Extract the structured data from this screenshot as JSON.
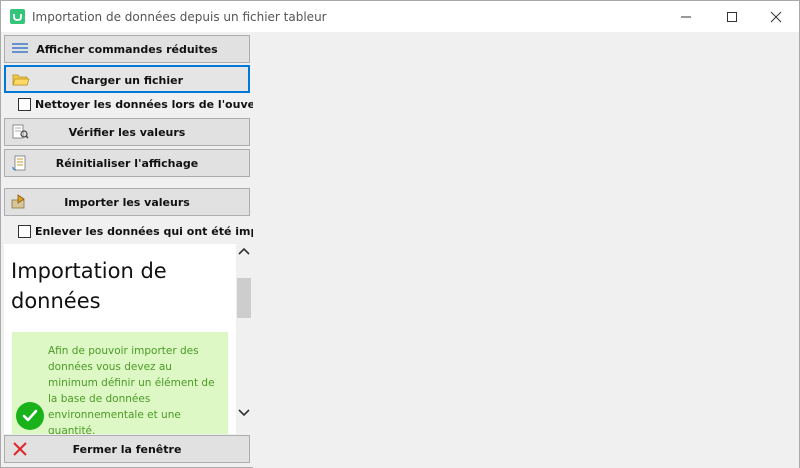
{
  "window": {
    "title": "Importation de données depuis un fichier tableur"
  },
  "commands": {
    "reduced": "Afficher commandes réduites",
    "load_file": "Charger un fichier",
    "clean_on_open": "Nettoyer les données lors de l'ouverture",
    "verify": "Vérifier les valeurs",
    "reset_view": "Réinitialiser l'affichage",
    "import": "Importer les valeurs",
    "remove_imported": "Enlever les données qui ont été importées",
    "close": "Fermer la fenêtre"
  },
  "checkboxes": {
    "clean_on_open_checked": false,
    "remove_imported_checked": false
  },
  "info": {
    "title": "Importation de données",
    "message": "Afin de pouvoir importer des données vous devez au minimum définir un élément de la base de données environnementale et une quantité."
  },
  "icons": {
    "reduced": "list-lines-icon",
    "load_file": "open-folder-icon",
    "verify": "check-document-icon",
    "reset_view": "refresh-document-icon",
    "import": "import-icon",
    "ok": "check-circle-icon",
    "close": "red-x-icon"
  },
  "colors": {
    "accent": "#0078d7",
    "success_bg": "#ddf7c5",
    "success_text": "#4b9c26",
    "ok_green": "#19b21a",
    "close_red": "#e0262a"
  }
}
